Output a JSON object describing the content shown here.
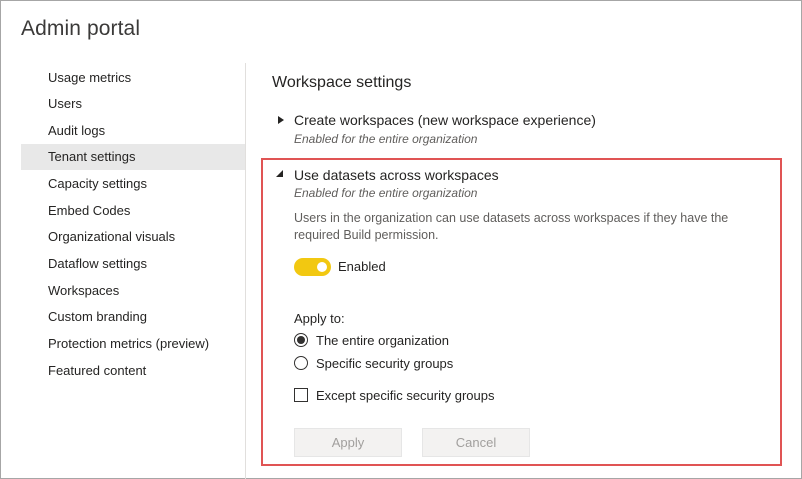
{
  "app": {
    "title": "Admin portal"
  },
  "sidebar": {
    "items": [
      {
        "label": "Usage metrics",
        "active": false
      },
      {
        "label": "Users",
        "active": false
      },
      {
        "label": "Audit logs",
        "active": false
      },
      {
        "label": "Tenant settings",
        "active": true
      },
      {
        "label": "Capacity settings",
        "active": false
      },
      {
        "label": "Embed Codes",
        "active": false
      },
      {
        "label": "Organizational visuals",
        "active": false
      },
      {
        "label": "Dataflow settings",
        "active": false
      },
      {
        "label": "Workspaces",
        "active": false
      },
      {
        "label": "Custom branding",
        "active": false
      },
      {
        "label": "Protection metrics (preview)",
        "active": false
      },
      {
        "label": "Featured content",
        "active": false
      }
    ]
  },
  "main": {
    "section_title": "Workspace settings",
    "settings": [
      {
        "title": "Create workspaces (new workspace experience)",
        "subtitle": "Enabled for the entire organization",
        "expanded": false
      },
      {
        "title": "Use datasets across workspaces",
        "subtitle": "Enabled for the entire organization",
        "expanded": true,
        "description": "Users in the organization can use datasets across workspaces if they have the required Build permission.",
        "toggle_label": "Enabled",
        "toggle_on": true,
        "apply_to_label": "Apply to:",
        "options": [
          {
            "label": "The entire organization",
            "checked": true
          },
          {
            "label": "Specific security groups",
            "checked": false
          }
        ],
        "except_label": "Except specific security groups",
        "except_checked": false,
        "apply_button": "Apply",
        "cancel_button": "Cancel"
      }
    ]
  },
  "colors": {
    "toggle_on": "#f2c811",
    "highlight_border": "#e05454",
    "active_item_bg": "#e8e8e8"
  }
}
